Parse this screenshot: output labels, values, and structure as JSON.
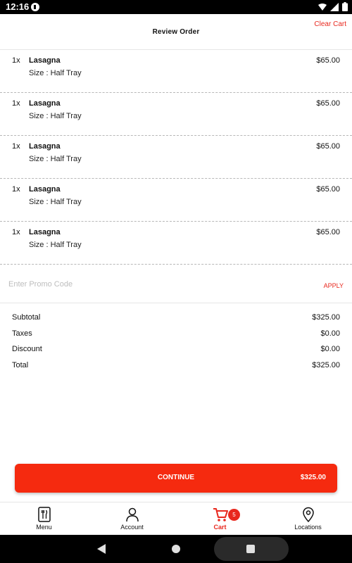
{
  "status_bar": {
    "time": "12:16"
  },
  "header": {
    "title": "Review Order",
    "clear_cart": "Clear Cart"
  },
  "items": [
    {
      "qty": "1x",
      "name": "Lasagna",
      "size": "Size : Half Tray",
      "price": "$65.00"
    },
    {
      "qty": "1x",
      "name": "Lasagna",
      "size": "Size : Half Tray",
      "price": "$65.00"
    },
    {
      "qty": "1x",
      "name": "Lasagna",
      "size": "Size : Half Tray",
      "price": "$65.00"
    },
    {
      "qty": "1x",
      "name": "Lasagna",
      "size": "Size : Half Tray",
      "price": "$65.00"
    },
    {
      "qty": "1x",
      "name": "Lasagna",
      "size": "Size : Half Tray",
      "price": "$65.00"
    }
  ],
  "promo": {
    "placeholder": "Enter Promo Code",
    "apply": "APPLY"
  },
  "totals": [
    {
      "label": "Subtotal",
      "value": "$325.00"
    },
    {
      "label": "Taxes",
      "value": "$0.00"
    },
    {
      "label": "Discount",
      "value": "$0.00"
    },
    {
      "label": "Total",
      "value": "$325.00"
    }
  ],
  "continue": {
    "label": "CONTINUE",
    "price": "$325.00"
  },
  "nav": {
    "menu": "Menu",
    "account": "Account",
    "cart": "Cart",
    "cart_badge": "5",
    "locations": "Locations"
  },
  "colors": {
    "accent": "#e8281e",
    "button": "#f52a0f"
  }
}
